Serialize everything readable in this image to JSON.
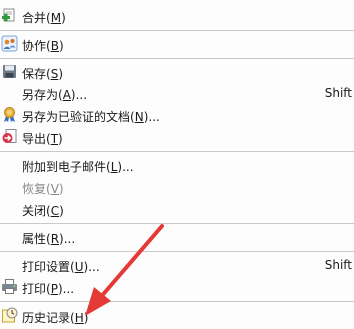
{
  "menu": {
    "items": [
      {
        "label": "合并",
        "key": "M",
        "icon": "merge-icon",
        "shortcut": ""
      },
      {
        "label": "协作",
        "key": "B",
        "icon": "collaborate-icon",
        "shortcut": ""
      },
      {
        "label": "保存",
        "key": "S",
        "icon": "save-icon",
        "shortcut": ""
      },
      {
        "label": "另存为",
        "key": "A",
        "suffix": "...",
        "shortcut": "Shift"
      },
      {
        "label": "另存为已验证的文档",
        "key": "N",
        "suffix": "...",
        "icon": "certified-document-icon"
      },
      {
        "label": "导出",
        "key": "T",
        "icon": "export-icon"
      },
      {
        "label": "附加到电子邮件",
        "key": "L",
        "suffix": "..."
      },
      {
        "label": "恢复",
        "key": "V",
        "disabled": true
      },
      {
        "label": "关闭",
        "key": "C"
      },
      {
        "label": "属性",
        "key": "R",
        "suffix": "..."
      },
      {
        "label": "打印设置",
        "key": "U",
        "suffix": "...",
        "shortcut": "Shift"
      },
      {
        "label": "打印",
        "key": "P",
        "suffix": "...",
        "icon": "printer-icon"
      },
      {
        "label": "历史记录",
        "key": "H",
        "icon": "history-icon"
      }
    ]
  },
  "colors": {
    "arrow": "#e53935"
  }
}
